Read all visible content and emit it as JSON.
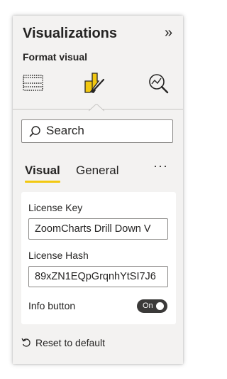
{
  "pane": {
    "title": "Visualizations",
    "collapse_icon": "double-chevron-right-icon",
    "subtitle": "Format visual"
  },
  "icons": {
    "build_visual": "table-grid-icon",
    "format_visual": "paintbrush-format-icon",
    "analytics": "magnifier-analytics-icon"
  },
  "colors": {
    "accent": "#f2c811",
    "pane_background": "#f3f2f1",
    "toggle_on": "#3b3a39"
  },
  "search": {
    "placeholder": "Search"
  },
  "tabs": {
    "visual": "Visual",
    "general": "General",
    "more": "···",
    "active": "Visual"
  },
  "fields": {
    "license_key_label": "License Key",
    "license_key_value": "ZoomCharts Drill Down V",
    "license_hash_label": "License Hash",
    "license_hash_value": "89xZN1EQpGrqnhYtSI7J6",
    "info_button_label": "Info button",
    "info_button_state": "On"
  },
  "footer": {
    "reset_label": "Reset to default"
  }
}
